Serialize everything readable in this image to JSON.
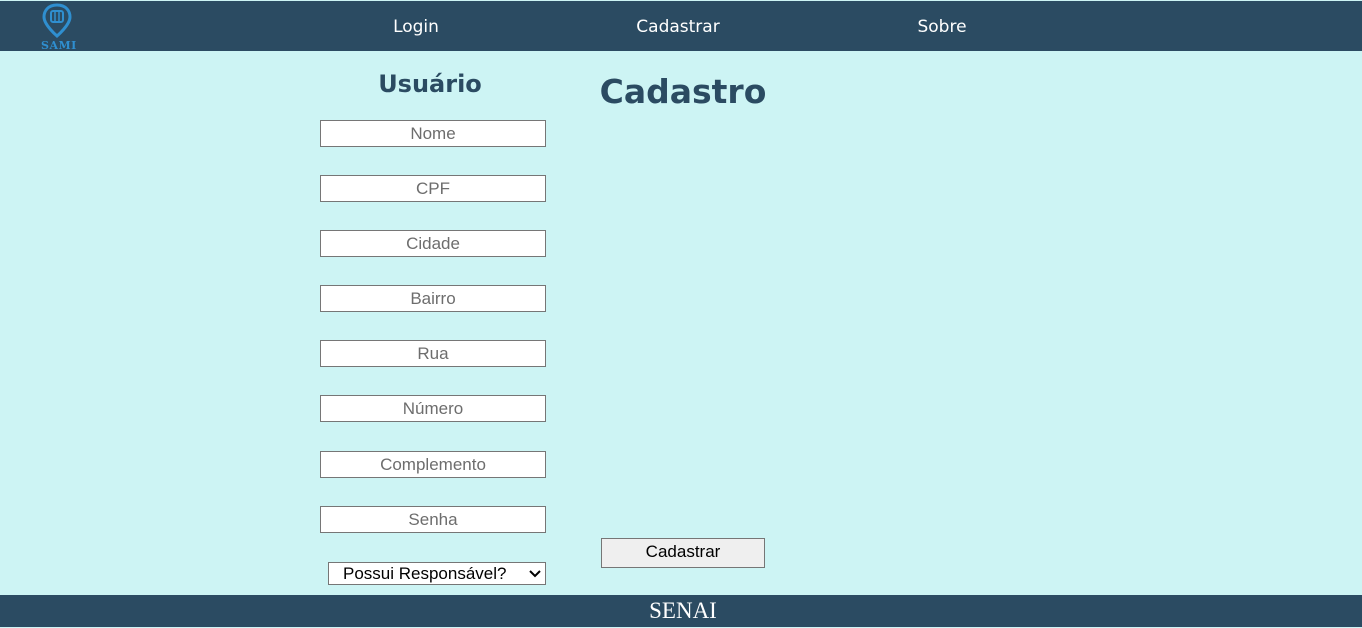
{
  "brand": {
    "logo_icon": "location-pin-icon",
    "logo_text": "SAMI"
  },
  "nav": {
    "login": "Login",
    "cadastrar": "Cadastrar",
    "sobre": "Sobre"
  },
  "form": {
    "section_title": "Usuário",
    "page_title": "Cadastro",
    "fields": {
      "nome": "Nome",
      "cpf": "CPF",
      "cidade": "Cidade",
      "bairro": "Bairro",
      "rua": "Rua",
      "numero": "Número",
      "complemento": "Complemento",
      "senha": "Senha"
    },
    "responsavel_select": "Possui Responsável?",
    "submit_label": "Cadastrar"
  },
  "footer": {
    "text": "SENAI"
  },
  "colors": {
    "background": "#cdf4f4",
    "nav_background": "#2b4b62",
    "title": "#2b4b62",
    "logo": "#2f8fd0"
  }
}
